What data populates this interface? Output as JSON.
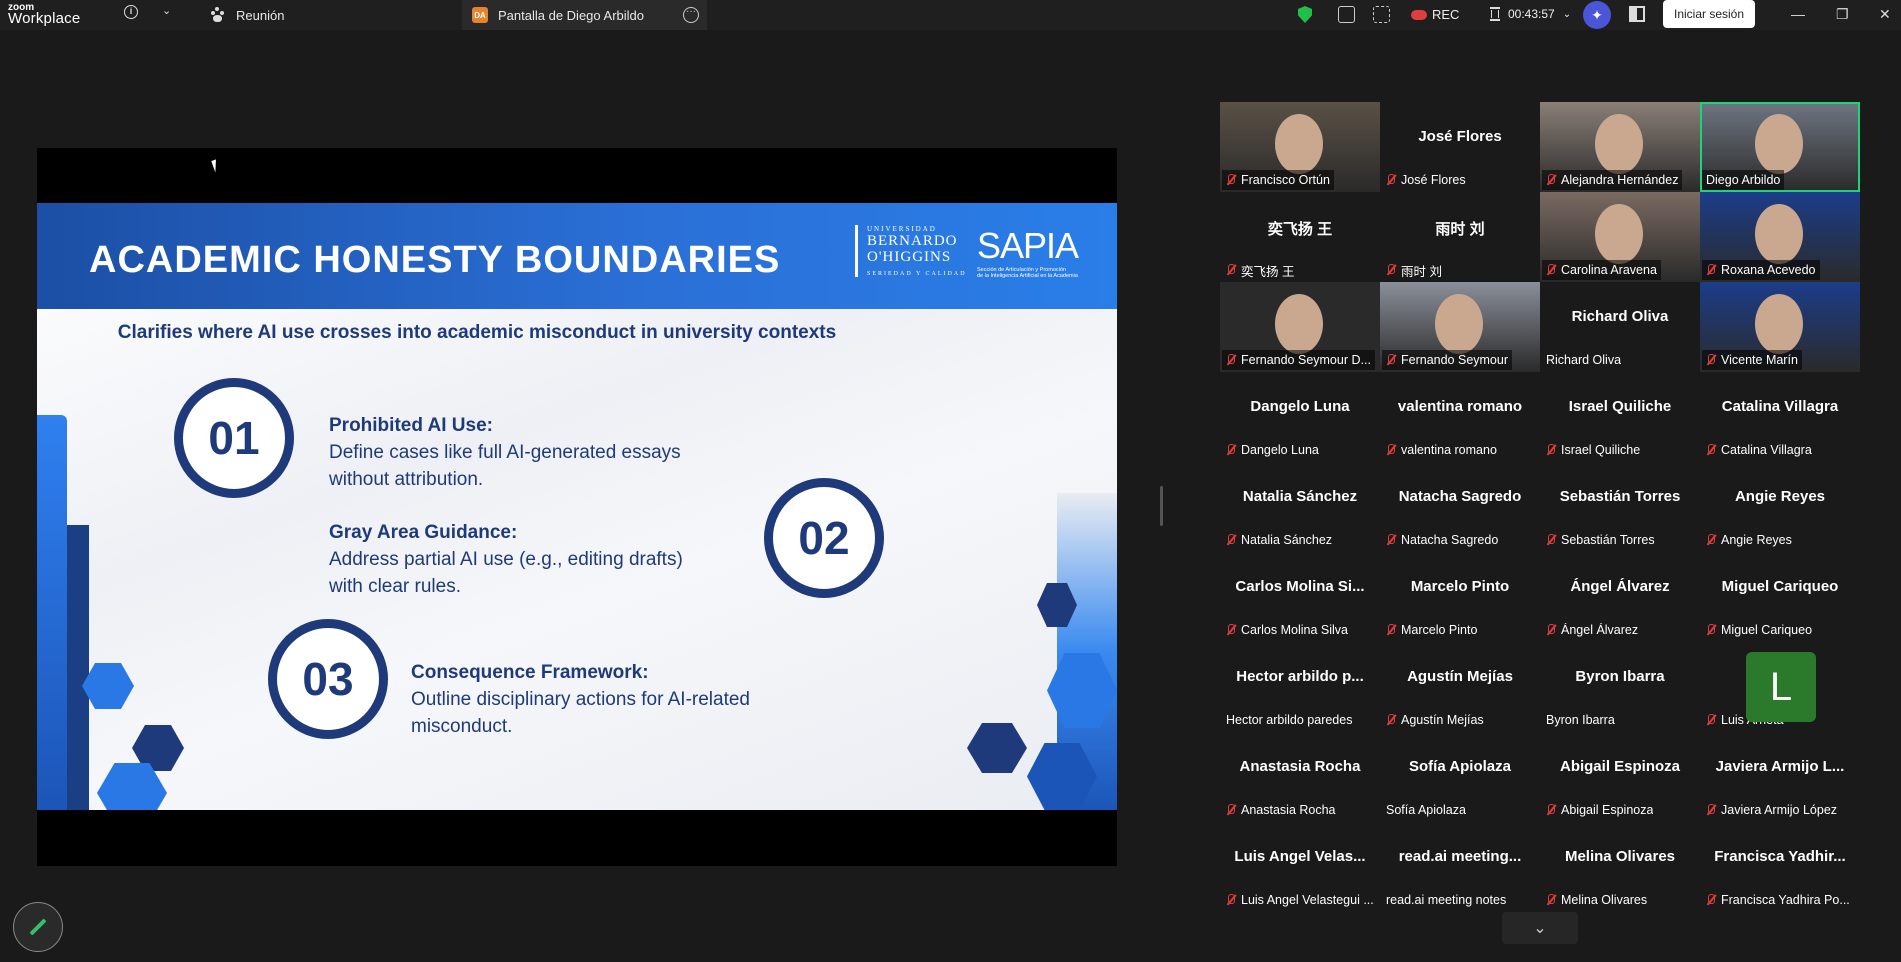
{
  "app": {
    "logo_line1": "zoom",
    "logo_line2": "Workplace"
  },
  "tabs": [
    {
      "label": "Reunión"
    },
    {
      "label": "Pantalla de Diego Arbildo",
      "badge": "DA"
    }
  ],
  "toolbar": {
    "rec_label": "REC",
    "timer": "00:43:57",
    "signin_label": "Iniciar sesión",
    "minimize": "—",
    "restore": "❐",
    "close": "✕"
  },
  "slide": {
    "title": "ACADEMIC HONESTY BOUNDARIES",
    "logo_ubo_top": "UNIVERSIDAD",
    "logo_ubo_name1": "BERNARDO",
    "logo_ubo_name2": "O'HIGGINS",
    "logo_ubo_tagline": "SERIEDAD Y CALIDAD",
    "logo_sapia": "SAPIA",
    "logo_sapia_sub1": "Sección de Articulación y Promoción",
    "logo_sapia_sub2": "de la Inteligencia Artificial en la Academia",
    "subtitle": "Clarifies where AI use crosses into academic misconduct in university contexts",
    "items": [
      {
        "number": "01",
        "heading": "Prohibited AI Use:",
        "body1": "Define cases like full AI-generated essays",
        "body2": "without attribution."
      },
      {
        "number": "02",
        "heading": "Gray Area Guidance:",
        "body1": "Address partial AI use (e.g., editing drafts)",
        "body2": "with clear rules."
      },
      {
        "number": "03",
        "heading": "Consequence Framework:",
        "body1": "Outline disciplinary actions for AI-related",
        "body2": "misconduct."
      }
    ]
  },
  "participants": [
    {
      "name": "Francisco Ortún",
      "label": "Francisco Ortún",
      "video": true,
      "muted": true
    },
    {
      "name": "José Flores",
      "label": "José Flores",
      "video": false,
      "muted": true
    },
    {
      "name": "Alejandra Hernández",
      "label": "Alejandra Hernández",
      "video": true,
      "muted": true
    },
    {
      "name": "Diego Arbildo",
      "label": "Diego Arbildo",
      "video": true,
      "muted": false,
      "speaking": true
    },
    {
      "name": "奕飞扬 王",
      "label": "奕飞扬 王",
      "video": false,
      "muted": true
    },
    {
      "name": "雨时 刘",
      "label": "雨时 刘",
      "video": false,
      "muted": true
    },
    {
      "name": "Carolina Aravena",
      "label": "Carolina Aravena",
      "video": true,
      "muted": true
    },
    {
      "name": "Roxana Acevedo",
      "label": "Roxana Acevedo",
      "video": true,
      "muted": true
    },
    {
      "name": "Fernando Seymour D...",
      "label": "Fernando Seymour D...",
      "video": true,
      "muted": true
    },
    {
      "name": "Fernando Seymour",
      "label": "Fernando Seymour",
      "video": true,
      "muted": true
    },
    {
      "name": "Richard Oliva",
      "label": "Richard Oliva",
      "video": false,
      "muted": false
    },
    {
      "name": "Vicente Marín",
      "label": "Vicente Marín",
      "video": true,
      "muted": true
    },
    {
      "name": "Dangelo Luna",
      "label": "Dangelo Luna",
      "video": false,
      "muted": true
    },
    {
      "name": "valentina romano",
      "label": "valentina romano",
      "video": false,
      "muted": true
    },
    {
      "name": "Israel Quiliche",
      "label": "Israel Quiliche",
      "video": false,
      "muted": true
    },
    {
      "name": "Catalina Villagra",
      "label": "Catalina Villagra",
      "video": false,
      "muted": true
    },
    {
      "name": "Natalia Sánchez",
      "label": "Natalia Sánchez",
      "video": false,
      "muted": true
    },
    {
      "name": "Natacha Sagredo",
      "label": "Natacha Sagredo",
      "video": false,
      "muted": true
    },
    {
      "name": "Sebastián Torres",
      "label": "Sebastián Torres",
      "video": false,
      "muted": true
    },
    {
      "name": "Angie Reyes",
      "label": "Angie Reyes",
      "video": false,
      "muted": true
    },
    {
      "name": "Carlos Molina Si...",
      "label": "Carlos Molina Silva",
      "video": false,
      "muted": true
    },
    {
      "name": "Marcelo Pinto",
      "label": "Marcelo Pinto",
      "video": false,
      "muted": true
    },
    {
      "name": "Ángel Álvarez",
      "label": "Ángel Álvarez",
      "video": false,
      "muted": true
    },
    {
      "name": "Miguel Cariqueo",
      "label": "Miguel Cariqueo",
      "video": false,
      "muted": true
    },
    {
      "name": "Hector arbildo p...",
      "label": "Hector arbildo paredes",
      "video": false,
      "muted": false
    },
    {
      "name": "Agustín Mejías",
      "label": "Agustín Mejías",
      "video": false,
      "muted": true
    },
    {
      "name": "Byron Ibarra",
      "label": "Byron Ibarra",
      "video": false,
      "muted": false
    },
    {
      "name": "",
      "label": "Luis Arrieta",
      "video": false,
      "muted": true,
      "avatar": "L"
    },
    {
      "name": "Anastasia Rocha",
      "label": "Anastasia Rocha",
      "video": false,
      "muted": true
    },
    {
      "name": "Sofía Apiolaza",
      "label": "Sofía Apiolaza",
      "video": false,
      "muted": false
    },
    {
      "name": "Abigail Espinoza",
      "label": "Abigail Espinoza",
      "video": false,
      "muted": true
    },
    {
      "name": "Javiera Armijo L...",
      "label": "Javiera Armijo López",
      "video": false,
      "muted": true
    },
    {
      "name": "Luis Angel Velas...",
      "label": "Luis Angel Velastegui ...",
      "video": false,
      "muted": true
    },
    {
      "name": "read.ai meeting...",
      "label": "read.ai meeting notes",
      "video": false,
      "muted": false
    },
    {
      "name": "Melina Olivares",
      "label": "Melina Olivares",
      "video": false,
      "muted": true
    },
    {
      "name": "Francisca Yadhir...",
      "label": "Francisca Yadhira Po...",
      "video": false,
      "muted": true
    }
  ],
  "colors": {
    "accent": "#1f3a7a",
    "speaking": "#1fd37a",
    "muted": "#e03d3d",
    "header_blue": "#2a6fd6"
  }
}
